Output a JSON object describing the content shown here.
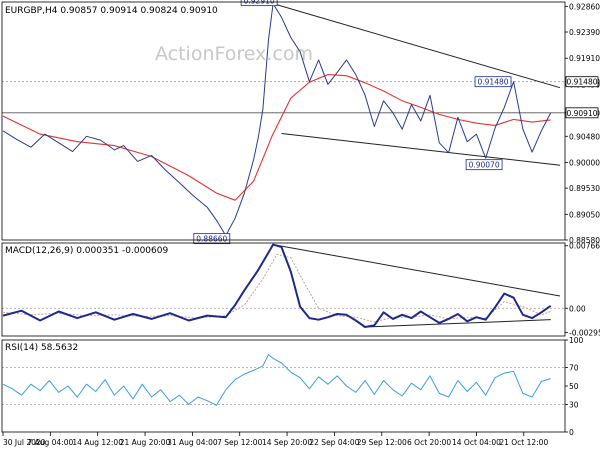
{
  "colors": {
    "price_line": "#2b3a8f",
    "ema": "#e8322f",
    "macd_line": "#1d2a8a",
    "signal_line": "#c9a0a0",
    "rsi_line": "#3a9ee8",
    "trendline": "#222222",
    "label_border": "#1d2a8a",
    "label_fill": "#ffffff",
    "label_text": "#1d2a8a",
    "grid_dotted": "#9a9a9a",
    "watermark": "#c8c8c8"
  },
  "watermark": "ActionForex.com",
  "chart_data": [
    {
      "type": "line",
      "title": "EURGBP,H4  0.90857 0.90914 0.90824 0.90910",
      "ylim": [
        0.8858,
        0.9294
      ],
      "y_ticks": [
        0.9286,
        0.9239,
        0.9191,
        0.9148,
        0.9143,
        0.9091,
        0.9048,
        0.9,
        0.8953,
        0.8905,
        0.8858
      ],
      "y_tick_labels": [
        "0.92860",
        "0.92390",
        "0.91910",
        "0.91480",
        "0.91430",
        "0.90910",
        "0.90480",
        "0.90000",
        "0.89530",
        "0.89050",
        "0.88580"
      ],
      "x_range": [
        0,
        60
      ],
      "price": [
        [
          0,
          0.9058
        ],
        [
          1.5,
          0.9042
        ],
        [
          3,
          0.9028
        ],
        [
          4.5,
          0.9052
        ],
        [
          6,
          0.9036
        ],
        [
          7.5,
          0.902
        ],
        [
          9,
          0.9048
        ],
        [
          10.5,
          0.9041
        ],
        [
          12,
          0.9023
        ],
        [
          13,
          0.9031
        ],
        [
          14.5,
          0.9002
        ],
        [
          16,
          0.9013
        ],
        [
          17.5,
          0.8986
        ],
        [
          19,
          0.8963
        ],
        [
          20.5,
          0.8939
        ],
        [
          22,
          0.8918
        ],
        [
          23,
          0.8894
        ],
        [
          24,
          0.8866
        ],
        [
          25,
          0.8898
        ],
        [
          26,
          0.8944
        ],
        [
          27,
          0.9006
        ],
        [
          27.5,
          0.9046
        ],
        [
          28,
          0.9098
        ],
        [
          28.6,
          0.9225
        ],
        [
          29.1,
          0.9291
        ],
        [
          30,
          0.9266
        ],
        [
          31,
          0.9229
        ],
        [
          32,
          0.9203
        ],
        [
          33,
          0.9148
        ],
        [
          34,
          0.9188
        ],
        [
          35,
          0.9143
        ],
        [
          36,
          0.9165
        ],
        [
          37,
          0.9188
        ],
        [
          38,
          0.9161
        ],
        [
          39,
          0.9123
        ],
        [
          40,
          0.9066
        ],
        [
          41,
          0.9113
        ],
        [
          42,
          0.9091
        ],
        [
          43,
          0.9061
        ],
        [
          44,
          0.9106
        ],
        [
          45,
          0.9076
        ],
        [
          46,
          0.9123
        ],
        [
          47,
          0.9036
        ],
        [
          48,
          0.9018
        ],
        [
          49,
          0.9083
        ],
        [
          50,
          0.9038
        ],
        [
          51,
          0.9052
        ],
        [
          52,
          0.9008
        ],
        [
          53,
          0.9063
        ],
        [
          54,
          0.9101
        ],
        [
          55,
          0.9148
        ],
        [
          56,
          0.9061
        ],
        [
          57,
          0.9019
        ],
        [
          58,
          0.9058
        ],
        [
          59,
          0.9091
        ]
      ],
      "ema": [
        [
          0,
          0.9085
        ],
        [
          4,
          0.9052
        ],
        [
          8,
          0.9038
        ],
        [
          12,
          0.9031
        ],
        [
          16,
          0.9011
        ],
        [
          20,
          0.8976
        ],
        [
          23,
          0.8944
        ],
        [
          25,
          0.8931
        ],
        [
          27,
          0.8966
        ],
        [
          29,
          0.9049
        ],
        [
          31,
          0.9118
        ],
        [
          33,
          0.9147
        ],
        [
          35,
          0.9161
        ],
        [
          37,
          0.9159
        ],
        [
          39,
          0.9146
        ],
        [
          41,
          0.9131
        ],
        [
          43,
          0.9113
        ],
        [
          45,
          0.9101
        ],
        [
          47,
          0.9088
        ],
        [
          49,
          0.9079
        ],
        [
          51,
          0.9072
        ],
        [
          53,
          0.9068
        ],
        [
          55,
          0.9079
        ],
        [
          57,
          0.9074
        ],
        [
          59,
          0.9078
        ]
      ],
      "trendlines": [
        [
          [
            29.1,
            0.9291
          ],
          [
            60,
            0.9137
          ]
        ],
        [
          [
            30,
            0.9053
          ],
          [
            60,
            0.8995
          ]
        ]
      ],
      "hlines": [
        {
          "y": 0.9148,
          "dotted": true
        },
        {
          "y": 0.9091,
          "dotted": false
        }
      ],
      "price_labels": [
        {
          "x": 24,
          "y": 0.8866,
          "text": "0.88660"
        },
        {
          "x": 29.1,
          "y": 0.9291,
          "text": "0.92910"
        },
        {
          "x": 51.5,
          "y": 0.9007,
          "text": "0.90070"
        },
        {
          "x": 54.4,
          "y": 0.9148,
          "text": "0.91480"
        }
      ],
      "axis_badges": [
        {
          "y": 0.9148,
          "text": "0.91480"
        },
        {
          "y": 0.9091,
          "text": "0.90910"
        }
      ]
    },
    {
      "type": "line",
      "title": "MACD(12,26,9) 0.000351 -0.000609",
      "ylim": [
        -0.0034,
        0.008
      ],
      "y_ticks": [
        0.007663,
        0.0,
        -0.002952
      ],
      "y_tick_labels": [
        "0.007663",
        "0.00",
        "-0.002952"
      ],
      "macd": [
        [
          0,
          -0.0009
        ],
        [
          2,
          -0.0003
        ],
        [
          4,
          -0.0015
        ],
        [
          6,
          -0.0004
        ],
        [
          8,
          -0.0012
        ],
        [
          10,
          -0.0005
        ],
        [
          12,
          -0.0014
        ],
        [
          14,
          -0.0007
        ],
        [
          16,
          -0.0013
        ],
        [
          18,
          -0.0006
        ],
        [
          20,
          -0.0015
        ],
        [
          22,
          -0.0009
        ],
        [
          24,
          -0.0011
        ],
        [
          25,
          0.0004
        ],
        [
          26,
          0.0022
        ],
        [
          27.5,
          0.0047
        ],
        [
          29.1,
          0.0078
        ],
        [
          30,
          0.0075
        ],
        [
          31,
          0.0045
        ],
        [
          32,
          0.0002
        ],
        [
          33,
          -0.0012
        ],
        [
          34,
          -0.0014
        ],
        [
          35,
          -0.0011
        ],
        [
          36,
          -0.0007
        ],
        [
          37,
          -0.0008
        ],
        [
          38,
          -0.0015
        ],
        [
          39,
          -0.0023
        ],
        [
          40,
          -0.0021
        ],
        [
          41,
          -0.0005
        ],
        [
          42,
          -0.0013
        ],
        [
          43,
          -0.0008
        ],
        [
          44,
          -0.0012
        ],
        [
          45,
          -0.0004
        ],
        [
          46,
          -0.0011
        ],
        [
          47,
          -0.0018
        ],
        [
          48,
          -0.0013
        ],
        [
          49,
          -0.0007
        ],
        [
          50,
          -0.0016
        ],
        [
          51,
          -0.0011
        ],
        [
          52,
          -0.0014
        ],
        [
          53,
          0.0001
        ],
        [
          54,
          0.0018
        ],
        [
          55,
          0.0013
        ],
        [
          56,
          -0.0008
        ],
        [
          57,
          -0.0012
        ],
        [
          58,
          -0.0005
        ],
        [
          59,
          0.0003
        ]
      ],
      "signal": [
        [
          0,
          -0.0005
        ],
        [
          3,
          -0.0008
        ],
        [
          6,
          -0.0006
        ],
        [
          9,
          -0.0009
        ],
        [
          12,
          -0.0008
        ],
        [
          15,
          -0.001
        ],
        [
          18,
          -0.0009
        ],
        [
          21,
          -0.0012
        ],
        [
          24,
          -0.0009
        ],
        [
          26,
          0.0004
        ],
        [
          28,
          0.0036
        ],
        [
          29.5,
          0.0066
        ],
        [
          31,
          0.0062
        ],
        [
          32.5,
          0.003
        ],
        [
          34,
          0.0
        ],
        [
          36,
          -0.0009
        ],
        [
          38,
          -0.0011
        ],
        [
          40,
          -0.0017
        ],
        [
          42,
          -0.0011
        ],
        [
          44,
          -0.0011
        ],
        [
          46,
          -0.0008
        ],
        [
          48,
          -0.0013
        ],
        [
          50,
          -0.0011
        ],
        [
          52,
          -0.0012
        ],
        [
          54,
          0.0008
        ],
        [
          56,
          0.0002
        ],
        [
          58,
          -0.0008
        ],
        [
          59,
          -0.0004
        ]
      ],
      "trendlines": [
        [
          [
            29.1,
            0.0078
          ],
          [
            60,
            0.0015
          ]
        ],
        [
          [
            39,
            -0.0023
          ],
          [
            59,
            -0.0014
          ]
        ]
      ],
      "hlines": [
        {
          "y": 0.0,
          "dotted": true
        }
      ]
    },
    {
      "type": "line",
      "title": "RSI(14) 58.5632",
      "ylim": [
        0,
        100
      ],
      "y_ticks": [
        100,
        70,
        50,
        30,
        0
      ],
      "y_tick_labels": [
        "100",
        "70",
        "50",
        "30",
        "0"
      ],
      "rsi": [
        [
          0,
          52
        ],
        [
          1,
          47
        ],
        [
          2,
          40
        ],
        [
          3,
          52
        ],
        [
          4,
          45
        ],
        [
          5,
          56
        ],
        [
          6,
          43
        ],
        [
          7,
          50
        ],
        [
          8,
          38
        ],
        [
          9,
          52
        ],
        [
          10,
          44
        ],
        [
          11,
          57
        ],
        [
          12,
          40
        ],
        [
          13,
          50
        ],
        [
          14,
          36
        ],
        [
          15,
          52
        ],
        [
          16,
          38
        ],
        [
          17,
          46
        ],
        [
          18,
          33
        ],
        [
          19,
          40
        ],
        [
          20,
          30
        ],
        [
          21,
          38
        ],
        [
          22,
          34
        ],
        [
          23,
          29
        ],
        [
          24,
          46
        ],
        [
          25,
          57
        ],
        [
          26,
          63
        ],
        [
          27,
          67
        ],
        [
          28,
          72
        ],
        [
          28.6,
          84
        ],
        [
          29.1,
          80
        ],
        [
          30,
          75
        ],
        [
          31,
          65
        ],
        [
          32,
          59
        ],
        [
          33,
          47
        ],
        [
          34,
          60
        ],
        [
          35,
          52
        ],
        [
          36,
          61
        ],
        [
          37,
          50
        ],
        [
          38,
          43
        ],
        [
          39,
          56
        ],
        [
          40,
          41
        ],
        [
          41,
          56
        ],
        [
          42,
          46
        ],
        [
          43,
          39
        ],
        [
          44,
          53
        ],
        [
          45,
          46
        ],
        [
          46,
          61
        ],
        [
          47,
          42
        ],
        [
          48,
          38
        ],
        [
          49,
          56
        ],
        [
          50,
          44
        ],
        [
          51,
          54
        ],
        [
          52,
          40
        ],
        [
          53,
          59
        ],
        [
          54,
          64
        ],
        [
          55,
          66
        ],
        [
          56,
          42
        ],
        [
          57,
          38
        ],
        [
          58,
          55
        ],
        [
          59,
          58
        ]
      ],
      "hlines": [
        {
          "y": 70,
          "dotted": true
        },
        {
          "y": 30,
          "dotted": true
        }
      ]
    }
  ],
  "x_axis": {
    "tick_labels": [
      "30 Jul 2020",
      "7 Aug 04:00",
      "14 Aug 12:00",
      "21 Aug 20:00",
      "31 Aug 04:00",
      "7 Sep 12:00",
      "14 Sep 20:00",
      "22 Sep 04:00",
      "29 Sep 12:00",
      "6 Oct 20:00",
      "14 Oct 04:00",
      "21 Oct 12:00"
    ],
    "tick_positions": [
      0,
      5.1,
      10.2,
      15.3,
      20.4,
      25.5,
      30.6,
      35.7,
      40.8,
      45.9,
      51.0,
      56.1
    ]
  }
}
